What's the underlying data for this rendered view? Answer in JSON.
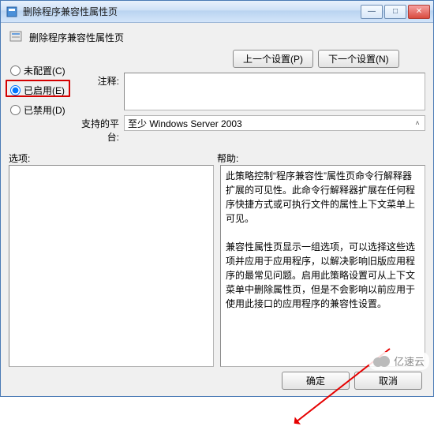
{
  "window": {
    "title": "删除程序兼容性属性页",
    "buttons": {
      "min": "—",
      "max": "□",
      "close": "✕"
    }
  },
  "header": {
    "title": "删除程序兼容性属性页"
  },
  "radios": {
    "not_configured": "未配置(C)",
    "enabled": "已启用(E)",
    "disabled": "已禁用(D)"
  },
  "nav": {
    "prev": "上一个设置(P)",
    "next": "下一个设置(N)"
  },
  "labels": {
    "remark": "注释:",
    "platform": "支持的平台:",
    "options": "选项:",
    "help": "帮助:"
  },
  "platform_value": "至少 Windows Server 2003",
  "help_text": {
    "p1": "此策略控制“程序兼容性”属性页命令行解释器扩展的可见性。此命令行解释器扩展在任何程序快捷方式或可执行文件的属性上下文菜单上可见。",
    "p2": "兼容性属性页显示一组选项，可以选择这些选项并应用于应用程序，以解决影响旧版应用程序的最常见问题。启用此策略设置可从上下文菜单中删除属性页，但是不会影响以前应用于使用此接口的应用程序的兼容性设置。"
  },
  "footer": {
    "ok": "确定",
    "cancel": "取消"
  },
  "watermark": "亿速云"
}
